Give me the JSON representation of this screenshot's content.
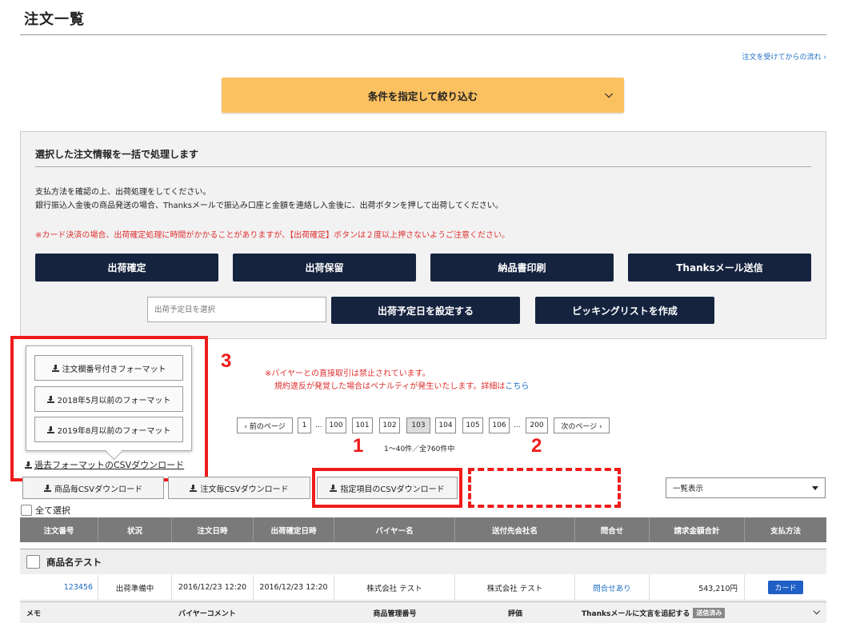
{
  "page": {
    "title": "注文一覧",
    "flow_link": "注文を受けてからの流れ ›"
  },
  "filter": {
    "label": "条件を指定して絞り込む"
  },
  "bulk": {
    "title": "選択した注文情報を一括で処理します",
    "desc1": "支払方法を確認の上、出荷処理をしてください。",
    "desc2": "銀行振込入金後の商品発送の場合、Thanksメールで振込み口座と金額を連絡し入金後に、出荷ボタンを押して出荷してください。",
    "warning": "※カード決済の場合、出荷確定処理に時間がかかることがありますが、【出荷確定】ボタンは２度以上押さないようご注意ください。",
    "buttons": [
      "出荷確定",
      "出荷保留",
      "納品書印刷",
      "Thanksメール送信"
    ],
    "date_placeholder": "出荷予定日を選択",
    "set_date_label": "出荷予定日を設定する",
    "picking_label": "ピッキングリストを作成"
  },
  "old_formats": {
    "items": [
      "注文欄番号付きフォーマット",
      "2018年5月以前のフォーマット",
      "2019年8月以前のフォーマット"
    ],
    "link": "過去フォーマットのCSVダウンロード"
  },
  "annotations": {
    "n1": "1",
    "n2": "2",
    "n3": "3"
  },
  "notice": {
    "line1": "※バイヤーとの直接取引は禁止されています。",
    "line2": "規約違反が発覚した場合はペナルティが発生いたします。詳細は",
    "link": "こちら"
  },
  "pagination": {
    "prev": "‹ 前のページ",
    "first": "1",
    "dots": "...",
    "pages": [
      "100",
      "101",
      "102",
      "103",
      "104",
      "105",
      "106"
    ],
    "current": "103",
    "last": "200",
    "next": "次のページ ›",
    "count": "1～40件／全760件中"
  },
  "csv": {
    "product": "商品毎CSVダウンロード",
    "order": "注文毎CSVダウンロード",
    "custom": "指定項目のCSVダウンロード",
    "view": "一覧表示"
  },
  "select_all": "全て選択",
  "table": {
    "headers": [
      "注文番号",
      "状況",
      "注文日時",
      "出荷確定日時",
      "バイヤー名",
      "送付先会社名",
      "問合せ",
      "請求金額合計",
      "支払方法"
    ],
    "group_name": "商品名テスト",
    "row": {
      "order_no": "123456",
      "status": "出荷準備中",
      "order_date": "2016/12/23 12:20",
      "ship_date": "2016/12/23 12:20",
      "buyer": "株式会社 テスト",
      "company": "株式会社 テスト",
      "inquiry": "問合せあり",
      "total": "543,210円",
      "payment": "カード"
    },
    "memo": {
      "memo": "メモ",
      "buyer_comment": "バイヤーコメント",
      "product_code": "商品管理番号",
      "rating": "評価",
      "thanks": "Thanksメールに文言を追記する",
      "sent": "送信済み"
    }
  },
  "colors": {
    "accent": "#fbc05f",
    "navy": "#15233f",
    "annotation": "#ef1b1b",
    "link": "#1a6cc4"
  }
}
